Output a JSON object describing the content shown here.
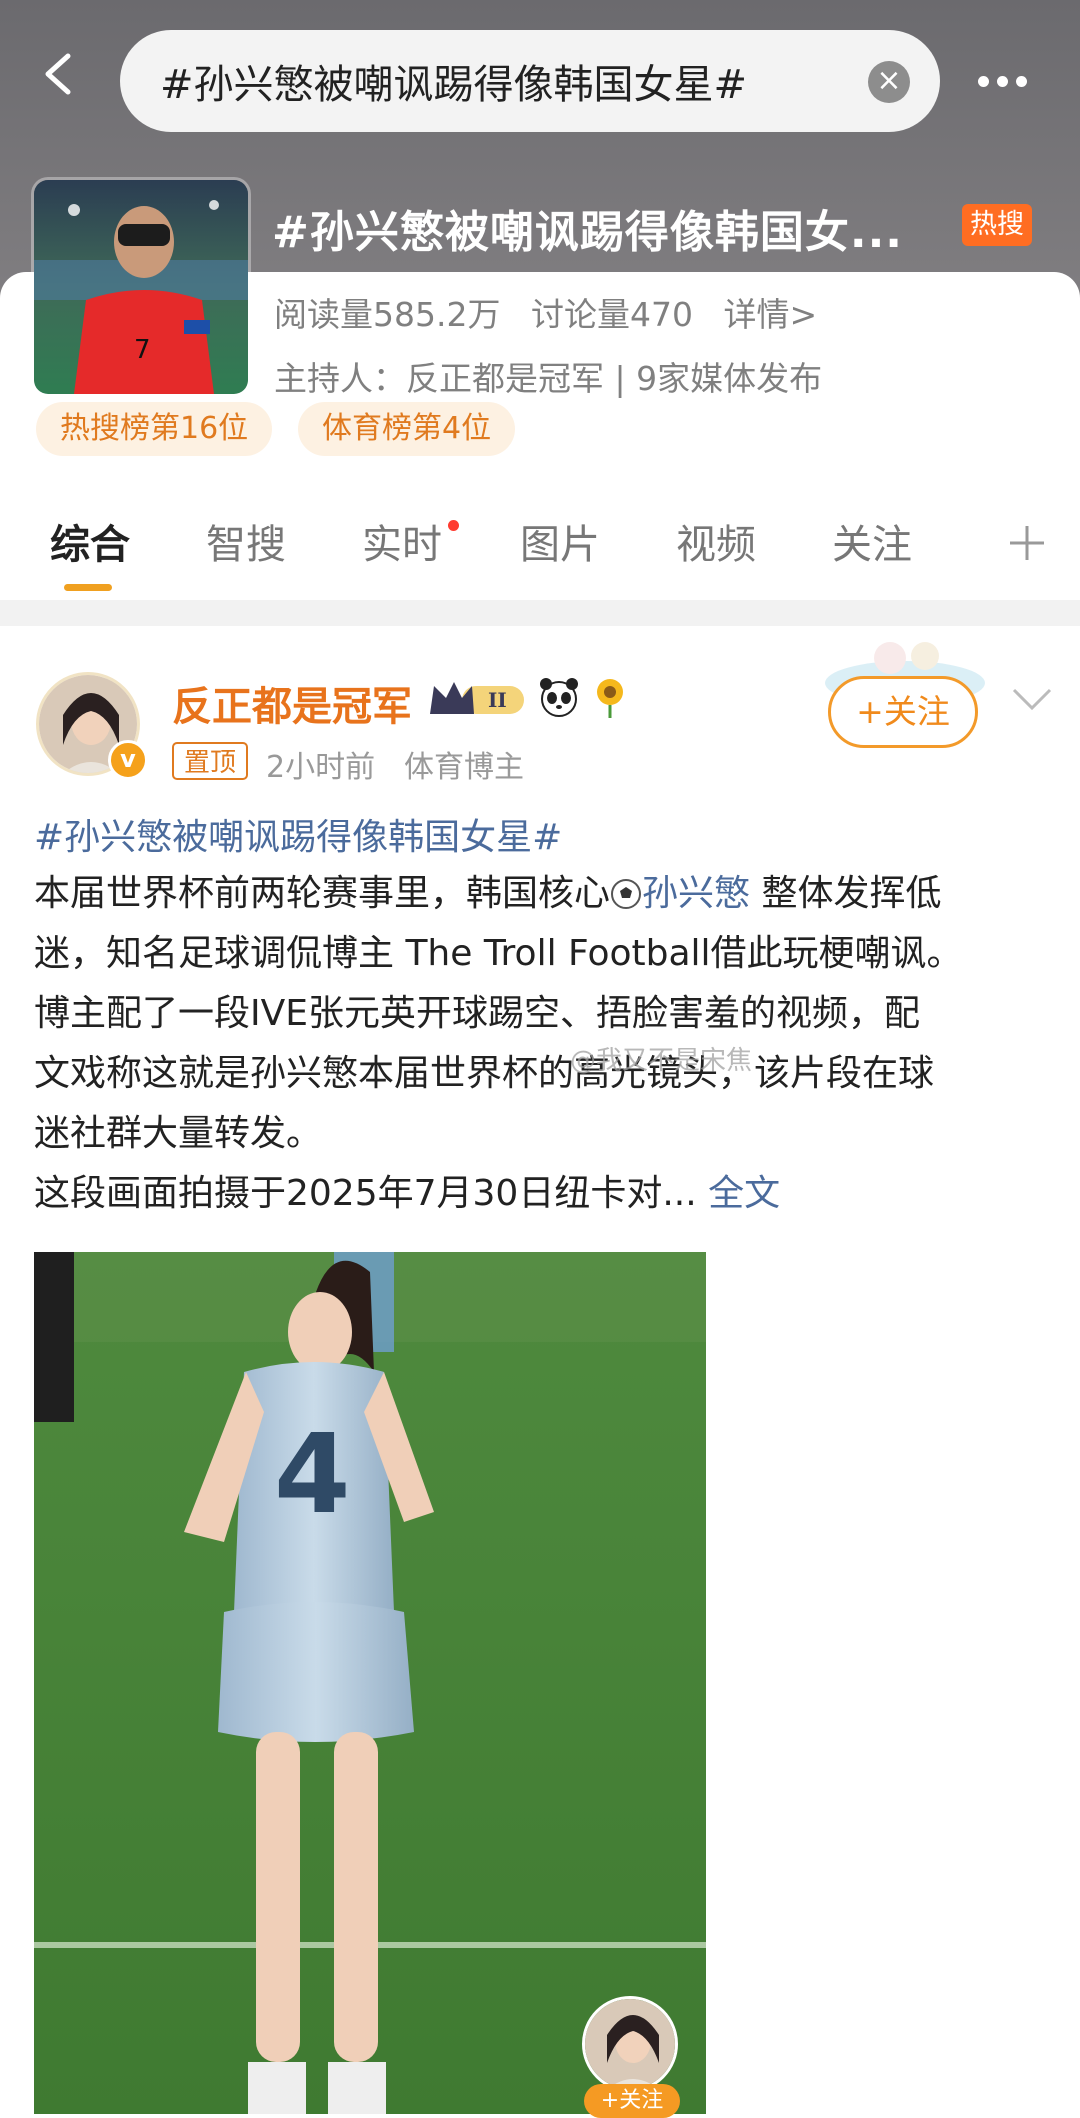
{
  "topbar": {
    "search_text": "#孙兴慜被嘲讽踢得像韩国女星#",
    "clear_symbol": "×",
    "icons": [
      "back-icon",
      "clear-icon",
      "more-icon"
    ]
  },
  "topic": {
    "title": "#孙兴慜被嘲讽踢得像韩国女...",
    "hot_badge": "热搜",
    "reads": "阅读量585.2万",
    "discussions": "讨论量470",
    "details": "详情>",
    "host": "主持人：反正都是冠军 | 9家媒体发布",
    "rank_hot": "热搜榜第16位",
    "rank_sport": "体育榜第4位",
    "accent_color": "#ff6d22"
  },
  "tabs": [
    {
      "label": "综合",
      "active": true
    },
    {
      "label": "智搜",
      "active": false
    },
    {
      "label": "实时",
      "active": false,
      "dot": true
    },
    {
      "label": "图片",
      "active": false
    },
    {
      "label": "视频",
      "active": false
    },
    {
      "label": "关注",
      "active": false
    },
    {
      "label": "+",
      "active": false
    }
  ],
  "post": {
    "author": "反正都是冠军",
    "level_badge": "II",
    "v_badge": "v",
    "pinned": "置顶",
    "time": "2小时前",
    "role": "体育博主",
    "follow_label": "+关注",
    "hashtag": "#孙兴慜被嘲讽踢得像韩国女星#",
    "line1_a": "本届世界杯前两轮赛事里，韩国核心",
    "line1_mention": "孙兴慜",
    "line1_b": " 整体发挥低",
    "line2": "迷，知名足球调侃博主 The Troll Football借此玩梗嘲讽。",
    "line3": "博主配了一段IVE张元英开球踢空、捂脸害羞的视频，配",
    "line4": "文戏称这就是孙兴慜本届世界杯的高光镜头，该片段在球",
    "line5": "迷社群大量转发。",
    "line6": "这段画面拍摄于2025年7月30日纽卡对...",
    "full_text": "全文",
    "watermark": "@我又不是宋焦",
    "image_jersey_number": "4",
    "image_follow_label": "+关注",
    "link_color": "#4b6b9c",
    "author_color": "#e8731c"
  }
}
